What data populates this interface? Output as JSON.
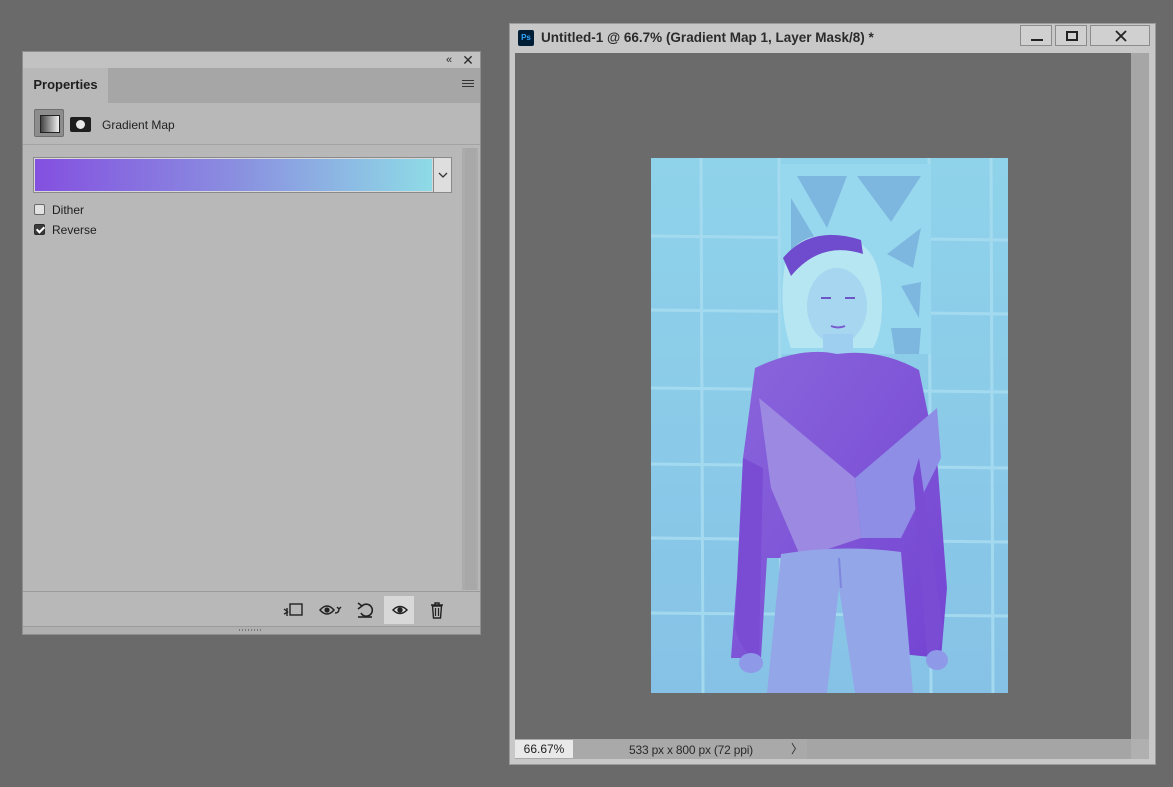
{
  "properties_panel": {
    "tab_label": "Properties",
    "collapse_glyph": "«",
    "close_glyph": "✕",
    "adjustment_title": "Gradient Map",
    "gradient": {
      "start_color": "#8450e0",
      "mid_color": "#8a8ee0",
      "end_color": "#8edbe6"
    },
    "options": [
      {
        "label": "Dither",
        "checked": false
      },
      {
        "label": "Reverse",
        "checked": true
      }
    ],
    "footer_icons": [
      "clip-to-layer-icon",
      "view-previous-state-icon",
      "reset-icon",
      "toggle-visibility-icon",
      "delete-icon"
    ]
  },
  "document": {
    "title": "Untitled-1 @ 66.7% (Gradient Map 1, Layer Mask/8) *",
    "app_badge": "Ps",
    "zoom": "66.67%",
    "doc_info": "533 px x 800 px (72 ppi)",
    "doc_info_arrow": "〉"
  },
  "colors": {
    "workspace_bg": "#6a6a6a",
    "panel_bg": "#b8b8b8",
    "image_light": "#8dd0e8",
    "image_dark": "#7a52d8"
  }
}
